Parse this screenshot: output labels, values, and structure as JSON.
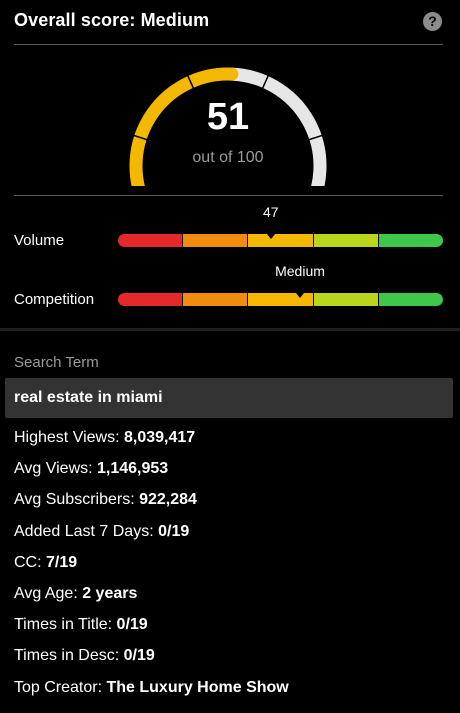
{
  "header": {
    "title": "Overall score: Medium",
    "help_icon": "question-icon"
  },
  "score": {
    "value": "51",
    "caption": "out of 100",
    "fraction": 0.51
  },
  "volume": {
    "label": "Volume",
    "value": "47",
    "level": 0.47
  },
  "competition": {
    "label": "Competition",
    "value": "Medium",
    "level": 0.56
  },
  "meter_colors": [
    "#e5282a",
    "#f28c0f",
    "#f5b800",
    "#b9d51c",
    "#3ec748"
  ],
  "gauge_colors": {
    "filled": "#f5b800",
    "empty": "#e6e6e6"
  },
  "search": {
    "label": "Search Term",
    "value": "real estate in miami"
  },
  "stats": [
    {
      "label": "Highest Views: ",
      "value": "8,039,417"
    },
    {
      "label": "Avg Views: ",
      "value": "1,146,953"
    },
    {
      "label": "Avg Subscribers: ",
      "value": "922,284"
    },
    {
      "label": "Added Last 7 Days: ",
      "value": "0/19"
    },
    {
      "label": "CC: ",
      "value": "7/19"
    },
    {
      "label": "Avg Age: ",
      "value": "2 years"
    },
    {
      "label": "Times in Title: ",
      "value": "0/19"
    },
    {
      "label": "Times in Desc: ",
      "value": "0/19"
    },
    {
      "label": "Top Creator: ",
      "value": "The Luxury Home Show"
    }
  ]
}
